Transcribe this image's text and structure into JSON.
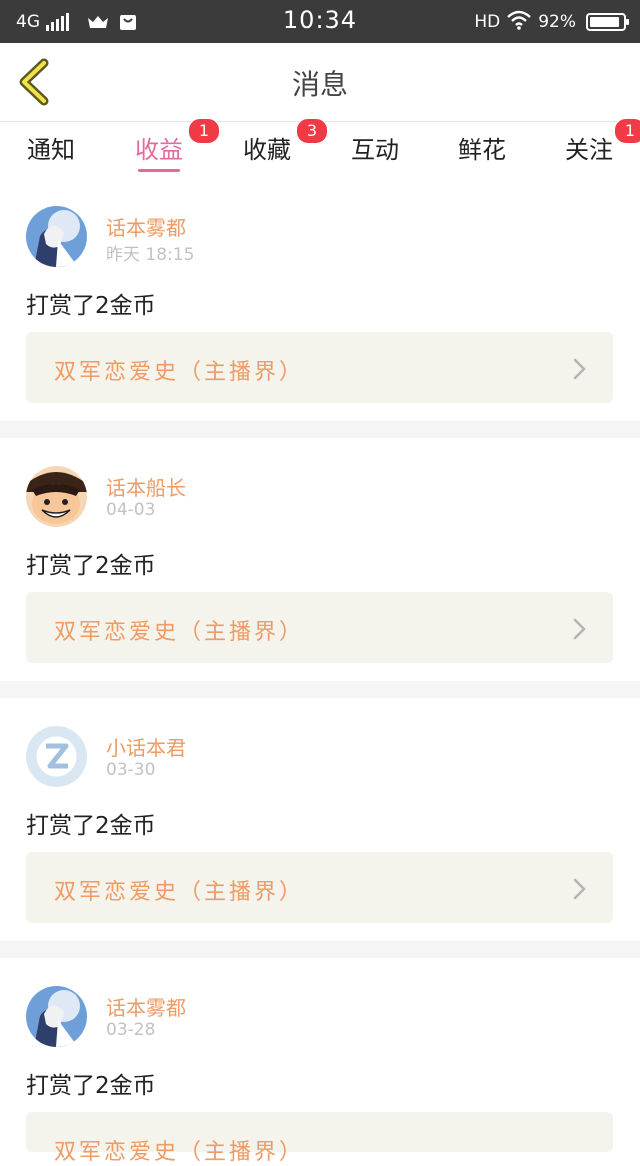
{
  "status_bar": {
    "network": "4G",
    "time": "10:34",
    "hd": "HD",
    "battery": "92%",
    "battery_level": 0.92
  },
  "header": {
    "title": "消息"
  },
  "tabs": [
    {
      "label": "通知",
      "badge": "",
      "active": false
    },
    {
      "label": "收益",
      "badge": "1",
      "active": true
    },
    {
      "label": "收藏",
      "badge": "3",
      "active": false
    },
    {
      "label": "互动",
      "badge": "",
      "active": false
    },
    {
      "label": "鲜花",
      "badge": "",
      "active": false
    },
    {
      "label": "关注",
      "badge": "1",
      "active": false
    }
  ],
  "messages": [
    {
      "user": "话本雾都",
      "time": "昨天 18:15",
      "text": "打赏了2金币",
      "work": "双军恋爱史（主播界）",
      "avatar": "anime-boy-avatar"
    },
    {
      "user": "话本船长",
      "time": "04-03",
      "text": "打赏了2金币",
      "work": "双军恋爱史（主播界）",
      "avatar": "straw-hat-avatar"
    },
    {
      "user": "小话本君",
      "time": "03-30",
      "text": "打赏了2金币",
      "work": "双军恋爱史（主播界）",
      "avatar": "default-q-avatar"
    },
    {
      "user": "话本雾都",
      "time": "03-28",
      "text": "打赏了2金币",
      "work": "双军恋爱史（主播界）",
      "avatar": "anime-boy-avatar"
    }
  ],
  "colors": {
    "accent": "#e26a9c",
    "username": "#ef9b63",
    "badge": "#f03a45",
    "work_bg": "#f4f3ec",
    "statusbar": "#3b3b3b"
  }
}
